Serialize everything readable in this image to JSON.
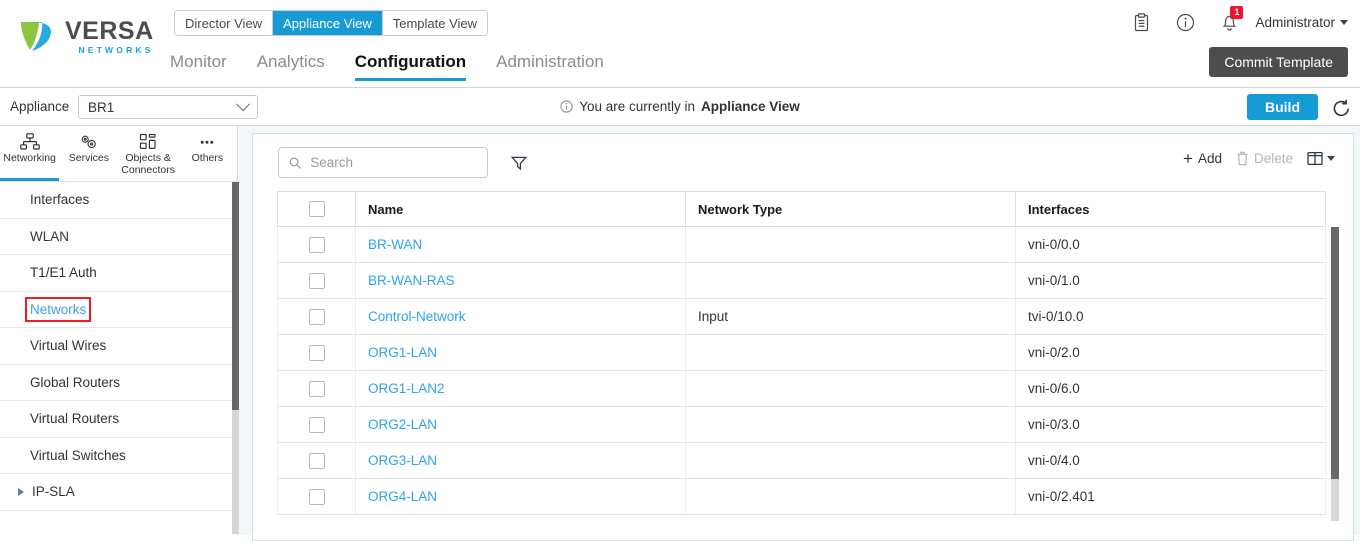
{
  "brand": {
    "name": "VERSA",
    "sub": "NETWORKS",
    "colors": {
      "accent": "#169bd5",
      "logo_green": "#8cc63e",
      "logo_blue": "#29abe2",
      "badge_red": "#e8192c"
    }
  },
  "view_toggle": {
    "options": [
      {
        "label": "Director View",
        "active": false
      },
      {
        "label": "Appliance View",
        "active": true
      },
      {
        "label": "Template View",
        "active": false
      }
    ]
  },
  "main_nav": {
    "items": [
      {
        "label": "Monitor",
        "active": false
      },
      {
        "label": "Analytics",
        "active": false
      },
      {
        "label": "Configuration",
        "active": true
      },
      {
        "label": "Administration",
        "active": false
      }
    ]
  },
  "top_icons": {
    "clipboard": "clipboard-icon",
    "info": "info-icon",
    "bell": "bell-icon",
    "notification_count": "1",
    "admin_label": "Administrator"
  },
  "commit": {
    "label": "Commit Template"
  },
  "appliance_bar": {
    "label": "Appliance",
    "selected": "BR1",
    "notice_prefix": "You are currently in",
    "notice_strong": "Appliance View",
    "build_label": "Build",
    "refresh": "refresh-icon"
  },
  "sidebar": {
    "tabs": [
      {
        "label": "Networking",
        "icon": "networking-icon",
        "active": true
      },
      {
        "label": "Services",
        "icon": "services-icon",
        "active": false
      },
      {
        "label": "Objects & Connectors",
        "icon": "objects-connectors-icon",
        "active": false
      },
      {
        "label": "Others",
        "icon": "others-icon",
        "active": false
      }
    ],
    "items": [
      {
        "label": "Interfaces",
        "expandable": false,
        "highlighted": false
      },
      {
        "label": "WLAN",
        "expandable": false,
        "highlighted": false
      },
      {
        "label": "T1/E1 Auth",
        "expandable": false,
        "highlighted": false
      },
      {
        "label": "Networks",
        "expandable": false,
        "highlighted": true
      },
      {
        "label": "Virtual Wires",
        "expandable": false,
        "highlighted": false
      },
      {
        "label": "Global Routers",
        "expandable": false,
        "highlighted": false
      },
      {
        "label": "Virtual Routers",
        "expandable": false,
        "highlighted": false
      },
      {
        "label": "Virtual Switches",
        "expandable": false,
        "highlighted": false
      },
      {
        "label": "IP-SLA",
        "expandable": true,
        "highlighted": false
      }
    ]
  },
  "toolbar": {
    "search_placeholder": "Search",
    "search_value": "",
    "filter_icon": "filter-funnel-icon",
    "add_label": "Add",
    "delete_label": "Delete",
    "delete_disabled": true,
    "columns_icon": "column-settings-icon"
  },
  "table": {
    "columns": [
      "Name",
      "Network Type",
      "Interfaces"
    ],
    "rows": [
      {
        "name": "BR-WAN",
        "network_type": "",
        "interfaces": "vni-0/0.0"
      },
      {
        "name": "BR-WAN-RAS",
        "network_type": "",
        "interfaces": "vni-0/1.0"
      },
      {
        "name": "Control-Network",
        "network_type": "Input",
        "interfaces": "tvi-0/10.0"
      },
      {
        "name": "ORG1-LAN",
        "network_type": "",
        "interfaces": "vni-0/2.0"
      },
      {
        "name": "ORG1-LAN2",
        "network_type": "",
        "interfaces": "vni-0/6.0"
      },
      {
        "name": "ORG2-LAN",
        "network_type": "",
        "interfaces": "vni-0/3.0"
      },
      {
        "name": "ORG3-LAN",
        "network_type": "",
        "interfaces": "vni-0/4.0"
      },
      {
        "name": "ORG4-LAN",
        "network_type": "",
        "interfaces": "vni-0/2.401"
      }
    ]
  }
}
